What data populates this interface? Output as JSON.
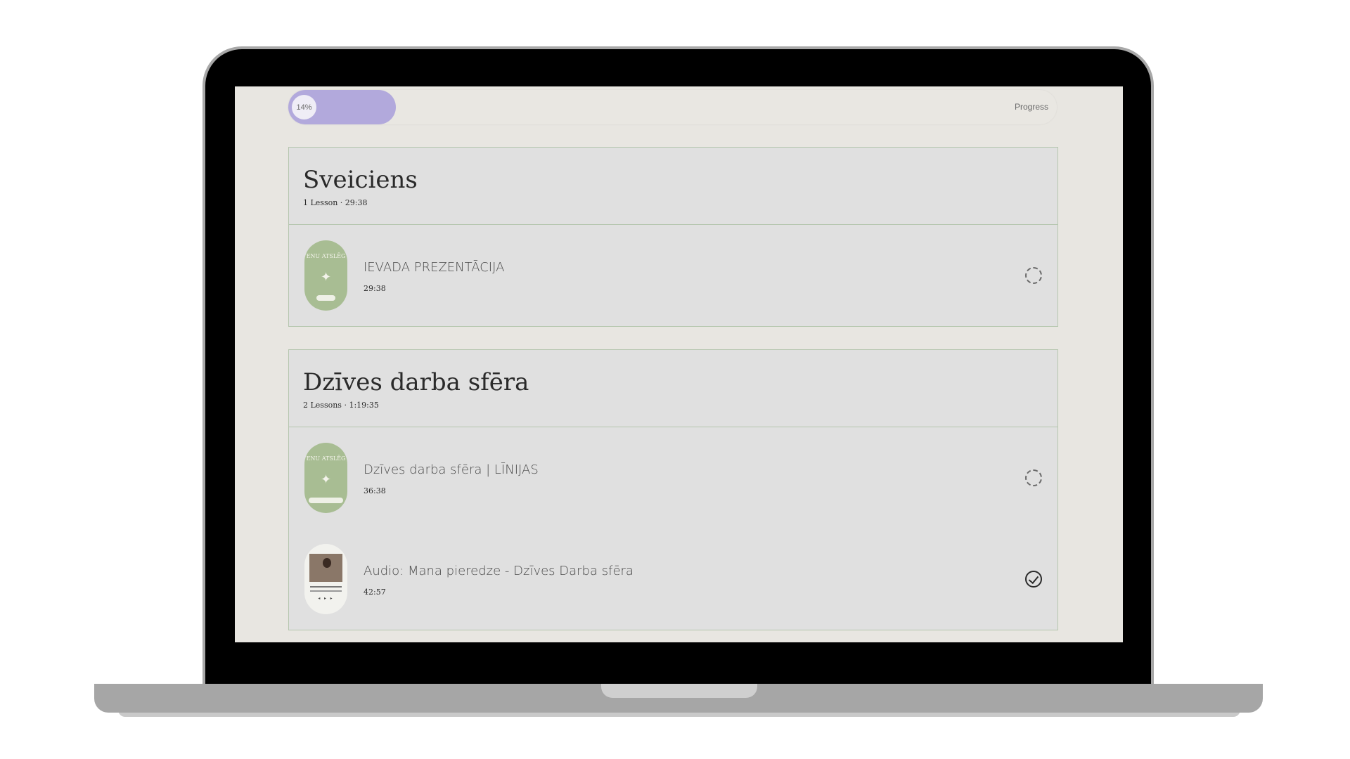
{
  "progress": {
    "percent_label": "14%",
    "value": 0.14,
    "label": "Progress"
  },
  "sections": [
    {
      "title": "Sveiciens",
      "meta": "1 Lesson · 29:38",
      "lessons": [
        {
          "title": "IEVADA PREZENTĀCIJA",
          "duration": "29:38",
          "thumb_text": "ENU ATSLĒG",
          "status": "incomplete",
          "status_icon": "dashed-circle-icon"
        }
      ]
    },
    {
      "title": "Dzīves darba sfēra",
      "meta": "2 Lessons · 1:19:35",
      "lessons": [
        {
          "title": "Dzīves darba sfēra | LĪNIJAS",
          "duration": "36:38",
          "thumb_text": "ENU ATSLĒG",
          "status": "incomplete",
          "status_icon": "dashed-circle-icon"
        },
        {
          "title": "Audio: Mana pieredze - Dzīves Darba sfēra",
          "duration": "42:57",
          "status": "complete",
          "status_icon": "check-circle-icon"
        }
      ]
    }
  ],
  "colors": {
    "progress_fill": "#b2a9dc",
    "section_border": "#b5c6ae",
    "thumb_green": "#a8bd93"
  }
}
